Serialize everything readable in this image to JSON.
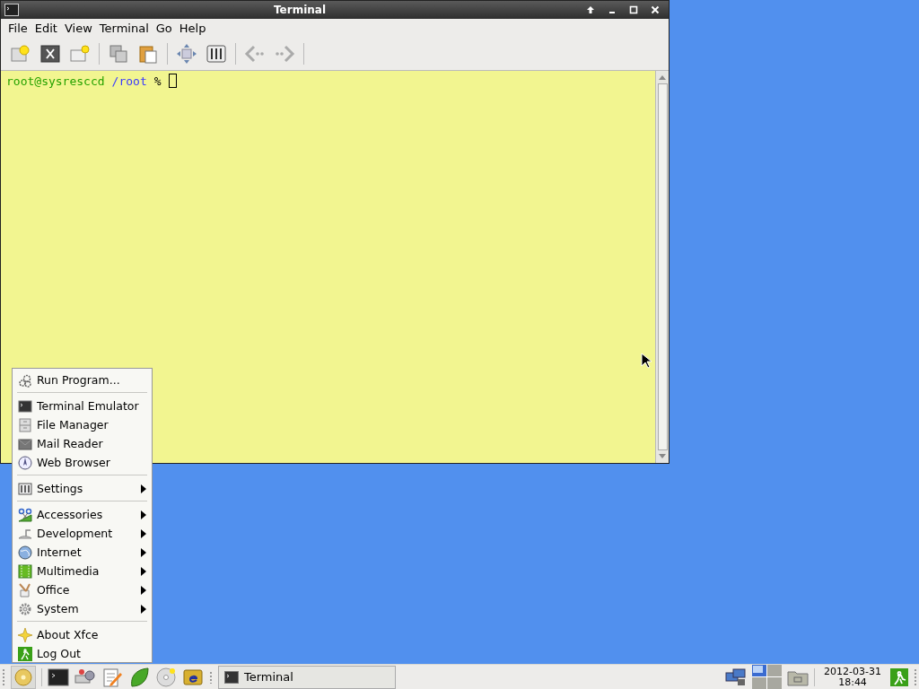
{
  "window": {
    "title": "Terminal",
    "menu_bar": [
      "File",
      "Edit",
      "View",
      "Terminal",
      "Go",
      "Help"
    ]
  },
  "terminal": {
    "user_host": "root@sysresccd",
    "path": "/root",
    "prompt_symbol": "%"
  },
  "start_menu": {
    "groups": [
      [
        {
          "label": "Run Program...",
          "submenu": false
        }
      ],
      [
        {
          "label": "Terminal Emulator",
          "submenu": false
        },
        {
          "label": "File Manager",
          "submenu": false
        },
        {
          "label": "Mail Reader",
          "submenu": false
        },
        {
          "label": "Web Browser",
          "submenu": false
        }
      ],
      [
        {
          "label": "Settings",
          "submenu": true
        }
      ],
      [
        {
          "label": "Accessories",
          "submenu": true
        },
        {
          "label": "Development",
          "submenu": true
        },
        {
          "label": "Internet",
          "submenu": true
        },
        {
          "label": "Multimedia",
          "submenu": true
        },
        {
          "label": "Office",
          "submenu": true
        },
        {
          "label": "System",
          "submenu": true
        }
      ],
      [
        {
          "label": "About Xfce",
          "submenu": false
        },
        {
          "label": "Log Out",
          "submenu": false
        }
      ]
    ]
  },
  "taskbar": {
    "tasks": [
      {
        "label": "Terminal"
      }
    ],
    "workspaces": [
      {
        "selected": true
      },
      {
        "selected": false
      },
      {
        "selected": false
      },
      {
        "selected": false
      }
    ],
    "clock": {
      "date": "2012-03-31",
      "time": "18:44"
    }
  }
}
